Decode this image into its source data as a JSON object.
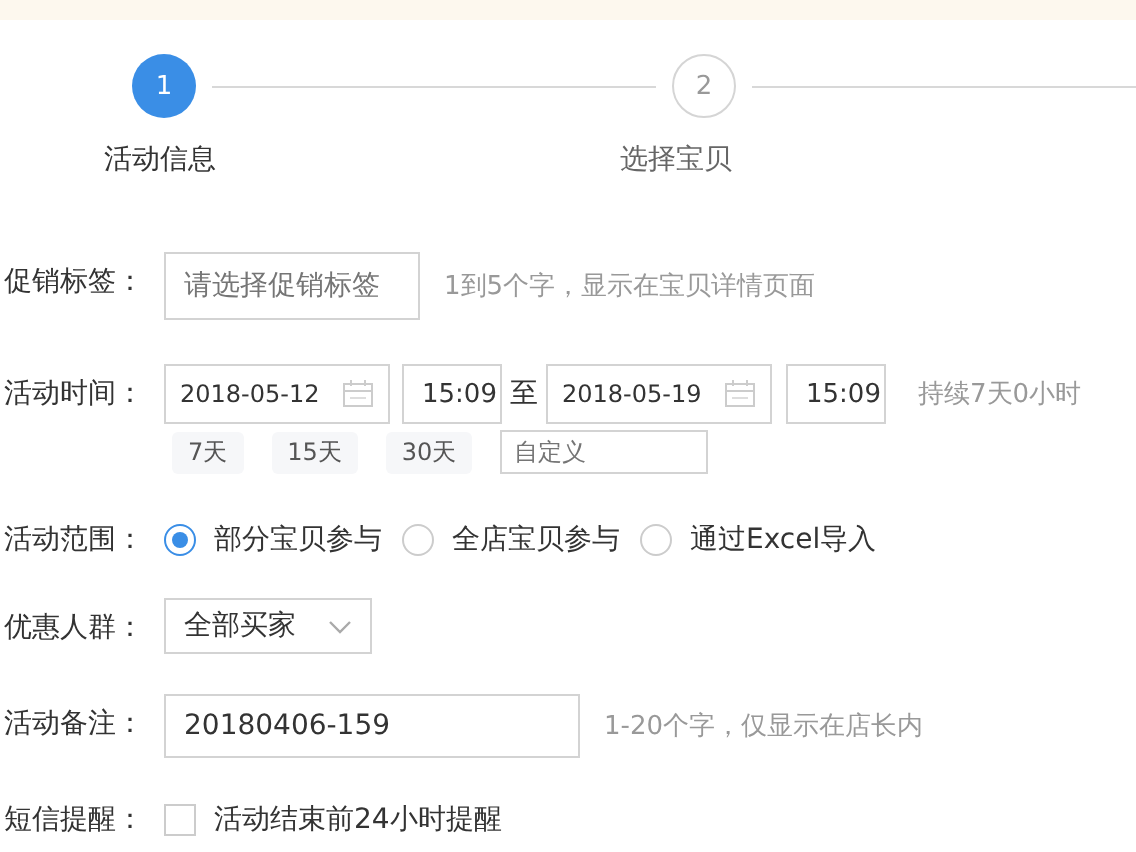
{
  "steps": [
    {
      "number": "1",
      "label": "活动信息",
      "selected": true
    },
    {
      "number": "2",
      "label": "选择宝贝",
      "selected": false
    }
  ],
  "form": [
    {
      "kind": "text",
      "label": "促销标签：",
      "placeholder": "请选择促销标签",
      "hint": "1到5个字，显示在宝贝详情页面"
    },
    {
      "kind": "time",
      "label": "活动时间：",
      "start_date": "2018-05-12",
      "start_time": "15:09",
      "separator": "至",
      "end_date": "2018-05-19",
      "end_time": "15:09",
      "hint": "持续7天0小时",
      "presets": [
        "7天",
        "15天",
        "30天"
      ],
      "custom_placeholder": "自定义"
    },
    {
      "kind": "radio",
      "label": "活动范围：",
      "options": [
        {
          "label": "部分宝贝参与",
          "selected": true
        },
        {
          "label": "全店宝贝参与",
          "selected": false
        },
        {
          "label": "通过Excel导入",
          "selected": false
        }
      ]
    },
    {
      "kind": "select",
      "label": "优惠人群：",
      "value": "全部买家"
    },
    {
      "kind": "note",
      "label": "活动备注：",
      "value": "20180406-159",
      "hint": "1-20个字，仅显示在店长内"
    },
    {
      "kind": "checkbox",
      "label": "短信提醒：",
      "text": "活动结束前24小时提醒",
      "checked": false
    }
  ]
}
